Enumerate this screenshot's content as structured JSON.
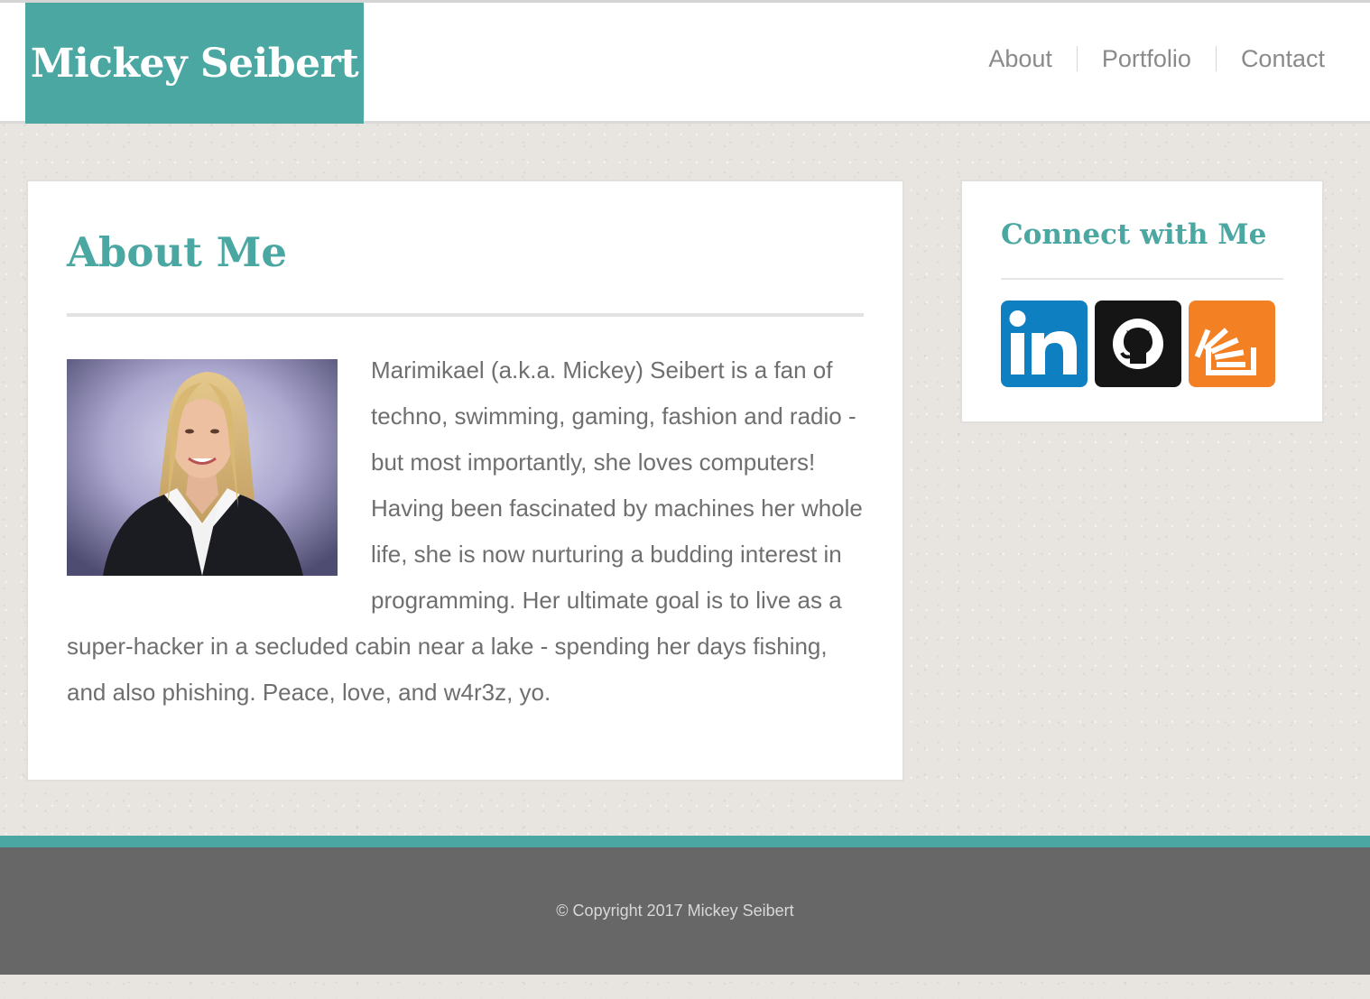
{
  "header": {
    "logo_text": "Mickey Seibert",
    "brand_color": "#4aa7a2",
    "nav": [
      {
        "label": "About"
      },
      {
        "label": "Portfolio"
      },
      {
        "label": "Contact"
      }
    ]
  },
  "main": {
    "title": "About Me",
    "photo_alt": "Portrait of Mickey Seibert",
    "bio": "Marimikael (a.k.a. Mickey) Seibert is a fan of techno, swimming, gaming, fashion and radio - but most importantly, she loves computers! Having been fascinated by machines her whole life, she is now nurturing a budding interest in programming. Her ultimate goal is to live as a super-hacker in a secluded cabin near a lake - spending her days fishing, and also phishing. Peace, love, and w4r3z, yo."
  },
  "sidebar": {
    "title": "Connect with Me",
    "social": [
      {
        "name": "LinkedIn",
        "icon": "linkedin-icon",
        "color": "#0e7fc0"
      },
      {
        "name": "GitHub",
        "icon": "github-icon",
        "color": "#151515"
      },
      {
        "name": "Stack Overflow",
        "icon": "stackoverflow-icon",
        "color": "#f48024"
      }
    ]
  },
  "footer": {
    "copyright": "© Copyright 2017 Mickey Seibert",
    "accent_color": "#4aa7a2",
    "background_color": "#676767"
  }
}
